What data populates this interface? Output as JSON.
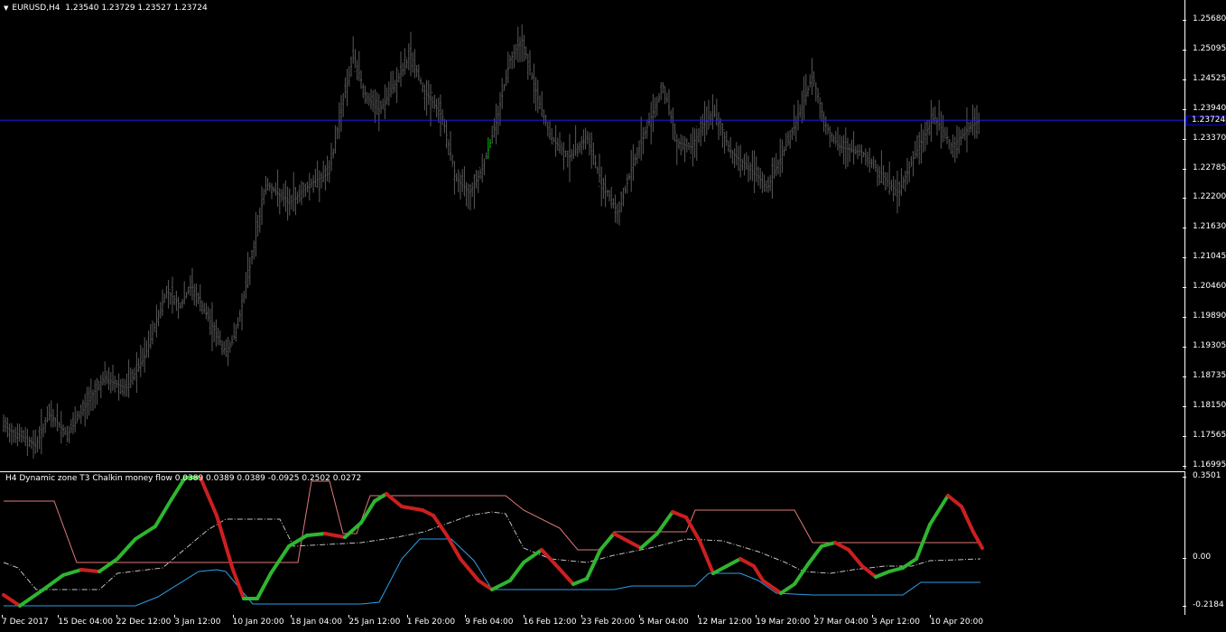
{
  "chart": {
    "symbol_timeframe": "EURUSD,H4",
    "ohlc": "1.23540 1.23729 1.23527 1.23724",
    "current_price": "1.23724",
    "colors": {
      "background": "#000000",
      "bars": "#5a5a5a",
      "last_bar": "#00c000",
      "price_line": "#1c1cff",
      "axis": "#ffffff"
    },
    "price_axis_ticks": [
      "1.25680",
      "1.25095",
      "1.24525",
      "1.23940",
      "1.23370",
      "1.22785",
      "1.22200",
      "1.21630",
      "1.21045",
      "1.20460",
      "1.19890",
      "1.19305",
      "1.18735",
      "1.18150",
      "1.17565",
      "1.16995"
    ],
    "time_axis_labels": [
      "7 Dec 2017",
      "15 Dec 04:00",
      "22 Dec 12:00",
      "3 Jan 12:00",
      "10 Jan 20:00",
      "18 Jan 04:00",
      "25 Jan 12:00",
      "1 Feb 20:00",
      "9 Feb 04:00",
      "16 Feb 12:00",
      "23 Feb 20:00",
      "5 Mar 04:00",
      "12 Mar 12:00",
      "19 Mar 20:00",
      "27 Mar 04:00",
      "3 Apr 12:00",
      "10 Apr 20:00"
    ]
  },
  "indicator": {
    "title": "H4  Dynamic zone T3 Chalkin money flow 0.0389 0.0389 0.0389 -0.0925 0.2502 0.0272",
    "axis_ticks": [
      "0.3501",
      "0.00",
      "-0.2184"
    ],
    "colors": {
      "up": "#2fb52f",
      "down": "#cc1f1f",
      "upper_zone": "#e07a7a",
      "lower_zone": "#2aa0e6",
      "middle": "#bfbfbf"
    }
  }
}
